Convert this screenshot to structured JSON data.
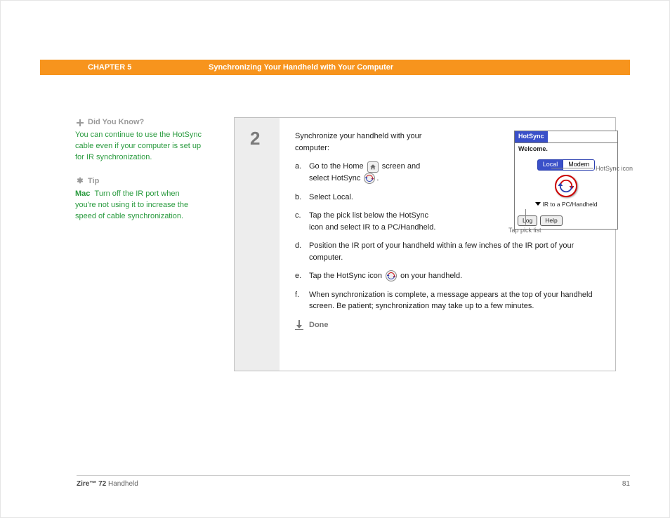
{
  "header": {
    "chapter": "CHAPTER 5",
    "title": "Synchronizing Your Handheld with Your Computer"
  },
  "sidebar": {
    "dyk": {
      "head": "Did You Know?",
      "body": "You can continue to use the HotSync cable even if your computer is set up for IR synchronization."
    },
    "tip": {
      "head": "Tip",
      "label": "Mac",
      "body": "Turn off the IR port when you're not using it to increase the speed of cable synchronization."
    }
  },
  "step": {
    "number": "2",
    "intro": "Synchronize your handheld with your computer:",
    "items": {
      "a_marker": "a.",
      "a_pre": "Go to the Home ",
      "a_mid": " screen and select HotSync ",
      "a_post": ".",
      "b_marker": "b.",
      "b": "Select Local.",
      "c_marker": "c.",
      "c": "Tap the pick list below the HotSync icon and select IR to a PC/Handheld.",
      "d_marker": "d.",
      "d": "Position the IR port of your handheld within a few inches of the IR port of your computer.",
      "e_marker": "e.",
      "e_pre": "Tap the HotSync icon ",
      "e_post": " on your handheld.",
      "f_marker": "f.",
      "f": "When synchronization is complete, a message appears at the top of your handheld screen. Be patient; synchronization may take up to a few minutes."
    },
    "done": "Done"
  },
  "palm": {
    "title": "HotSync",
    "welcome": "Welcome.",
    "tab_local": "Local",
    "tab_modem": "Modem",
    "picklist": "IR to a PC/Handheld",
    "btn_log": "Log",
    "btn_help": "Help",
    "annot_icon": "HotSync icon",
    "annot_pick": "Tap pick list"
  },
  "footer": {
    "product_bold": "Zire™ 72",
    "product_rest": " Handheld",
    "page": "81"
  }
}
